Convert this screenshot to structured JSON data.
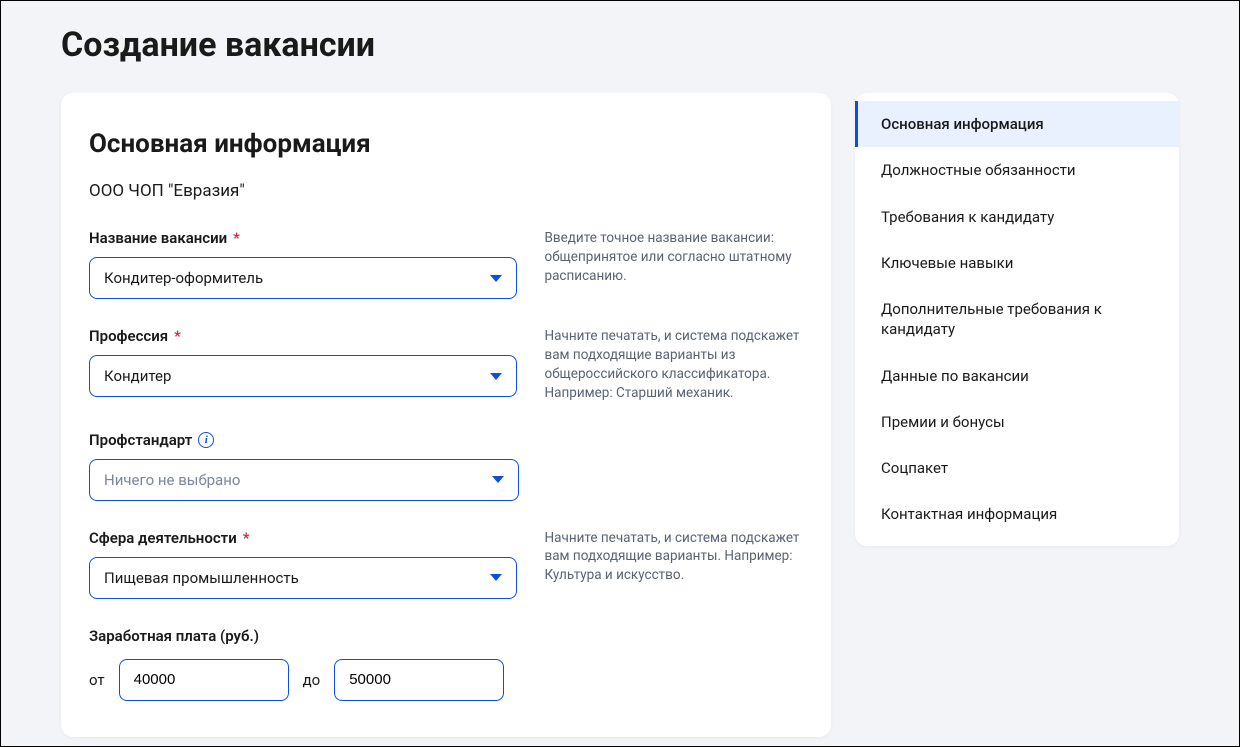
{
  "page_title": "Создание вакансии",
  "main": {
    "section_title": "Основная информация",
    "company_name": "ООО ЧОП \"Евразия\"",
    "fields": {
      "job_title": {
        "label": "Название вакансии",
        "required": true,
        "value": "Кондитер-оформитель",
        "hint": "Введите точное название вакансии: общепринятое или согласно штатному расписанию."
      },
      "profession": {
        "label": "Профессия",
        "required": true,
        "value": "Кондитер",
        "hint": "Начните печатать, и система подскажет вам подходящие варианты из общероссийского классификатора. Например: Старший механик."
      },
      "profstandard": {
        "label": "Профстандарт",
        "required": false,
        "placeholder": "Ничего не выбрано"
      },
      "sphere": {
        "label": "Сфера деятельности",
        "required": true,
        "value": "Пищевая промышленность",
        "hint": "Начните печатать, и система подскажет вам подходящие варианты. Например: Культура и искусство."
      },
      "salary": {
        "label": "Заработная плата (руб.)",
        "from_prefix": "от",
        "to_prefix": "до",
        "from": "40000",
        "to": "50000"
      }
    }
  },
  "sidebar": {
    "items": [
      {
        "label": "Основная информация",
        "active": true
      },
      {
        "label": "Должностные обязанности",
        "active": false
      },
      {
        "label": "Требования к кандидату",
        "active": false
      },
      {
        "label": "Ключевые навыки",
        "active": false
      },
      {
        "label": "Дополнительные требования к кандидату",
        "active": false
      },
      {
        "label": "Данные по вакансии",
        "active": false
      },
      {
        "label": "Премии и бонусы",
        "active": false
      },
      {
        "label": "Соцпакет",
        "active": false
      },
      {
        "label": "Контактная информация",
        "active": false
      }
    ]
  }
}
